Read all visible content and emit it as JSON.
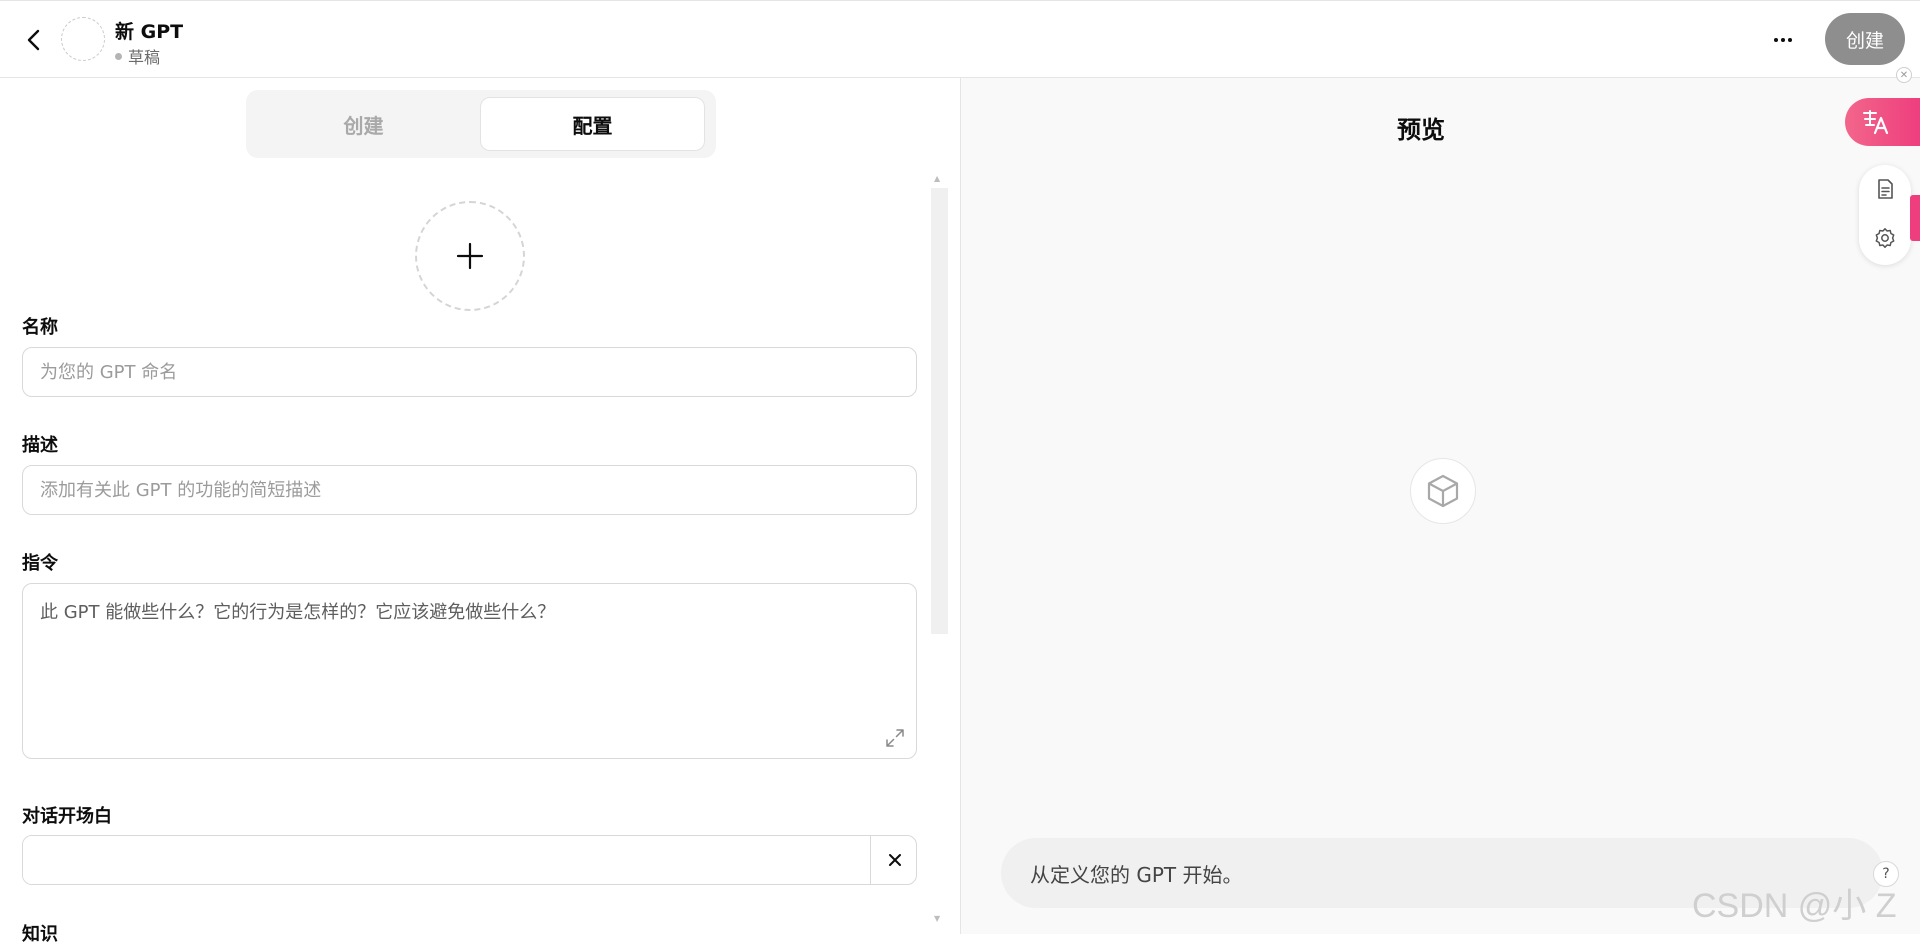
{
  "header": {
    "gpt_name": "新 GPT",
    "status": "草稿",
    "create_button": "创建"
  },
  "tabs": {
    "create": "创建",
    "configure": "配置"
  },
  "form": {
    "name_label": "名称",
    "name_placeholder": "为您的 GPT 命名",
    "description_label": "描述",
    "description_placeholder": "添加有关此 GPT 的功能的简短描述",
    "instructions_label": "指令",
    "instructions_placeholder": "此 GPT 能做些什么？它的行为是怎样的？它应该避免做些什么？",
    "starters_label": "对话开场白",
    "knowledge_label": "知识"
  },
  "preview": {
    "title": "预览",
    "message_placeholder": "从定义您的 GPT 开始。"
  },
  "watermark": "CSDN @小 Z",
  "help": "?",
  "colors": {
    "accent_pink": "#ee3e7e",
    "create_button_bg": "#8e8e8e",
    "preview_bg": "#f9f9f9"
  },
  "icons": [
    "back-arrow-icon",
    "more-icon",
    "plus-icon",
    "expand-icon",
    "close-icon",
    "cube-icon",
    "translate-icon",
    "document-icon",
    "gear-icon"
  ]
}
